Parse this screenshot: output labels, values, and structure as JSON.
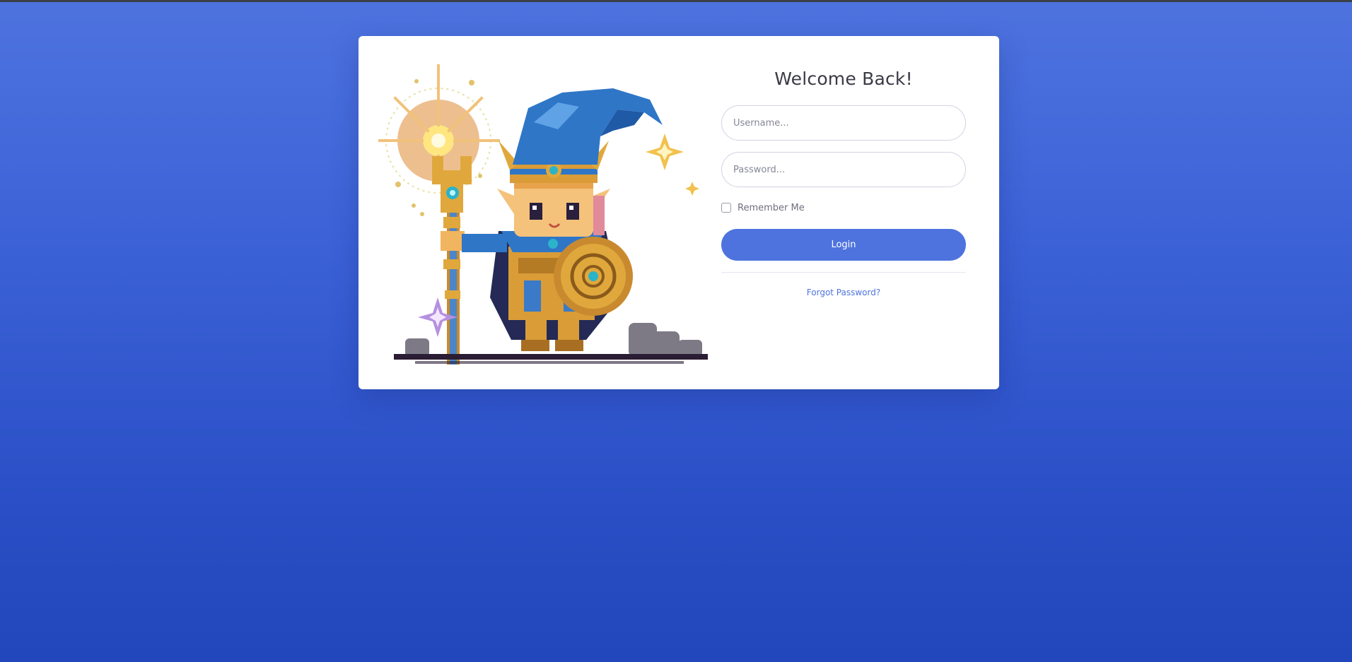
{
  "login": {
    "title": "Welcome Back!",
    "username_placeholder": "Username...",
    "username_value": "",
    "password_placeholder": "Password...",
    "password_value": "",
    "remember_label": "Remember Me",
    "remember_checked": false,
    "login_label": "Login",
    "forgot_label": "Forgot Password?"
  },
  "illustration": {
    "subject": "pixel-art wizard with staff and shield",
    "icon": "wizard-illustration"
  },
  "colors": {
    "background_top": "#4e73df",
    "background_bottom": "#2246bb",
    "card": "#ffffff",
    "accent": "#4e73df",
    "title_text": "#3a3b45",
    "muted_text": "#6e707e",
    "input_border": "#d1d3e2"
  }
}
